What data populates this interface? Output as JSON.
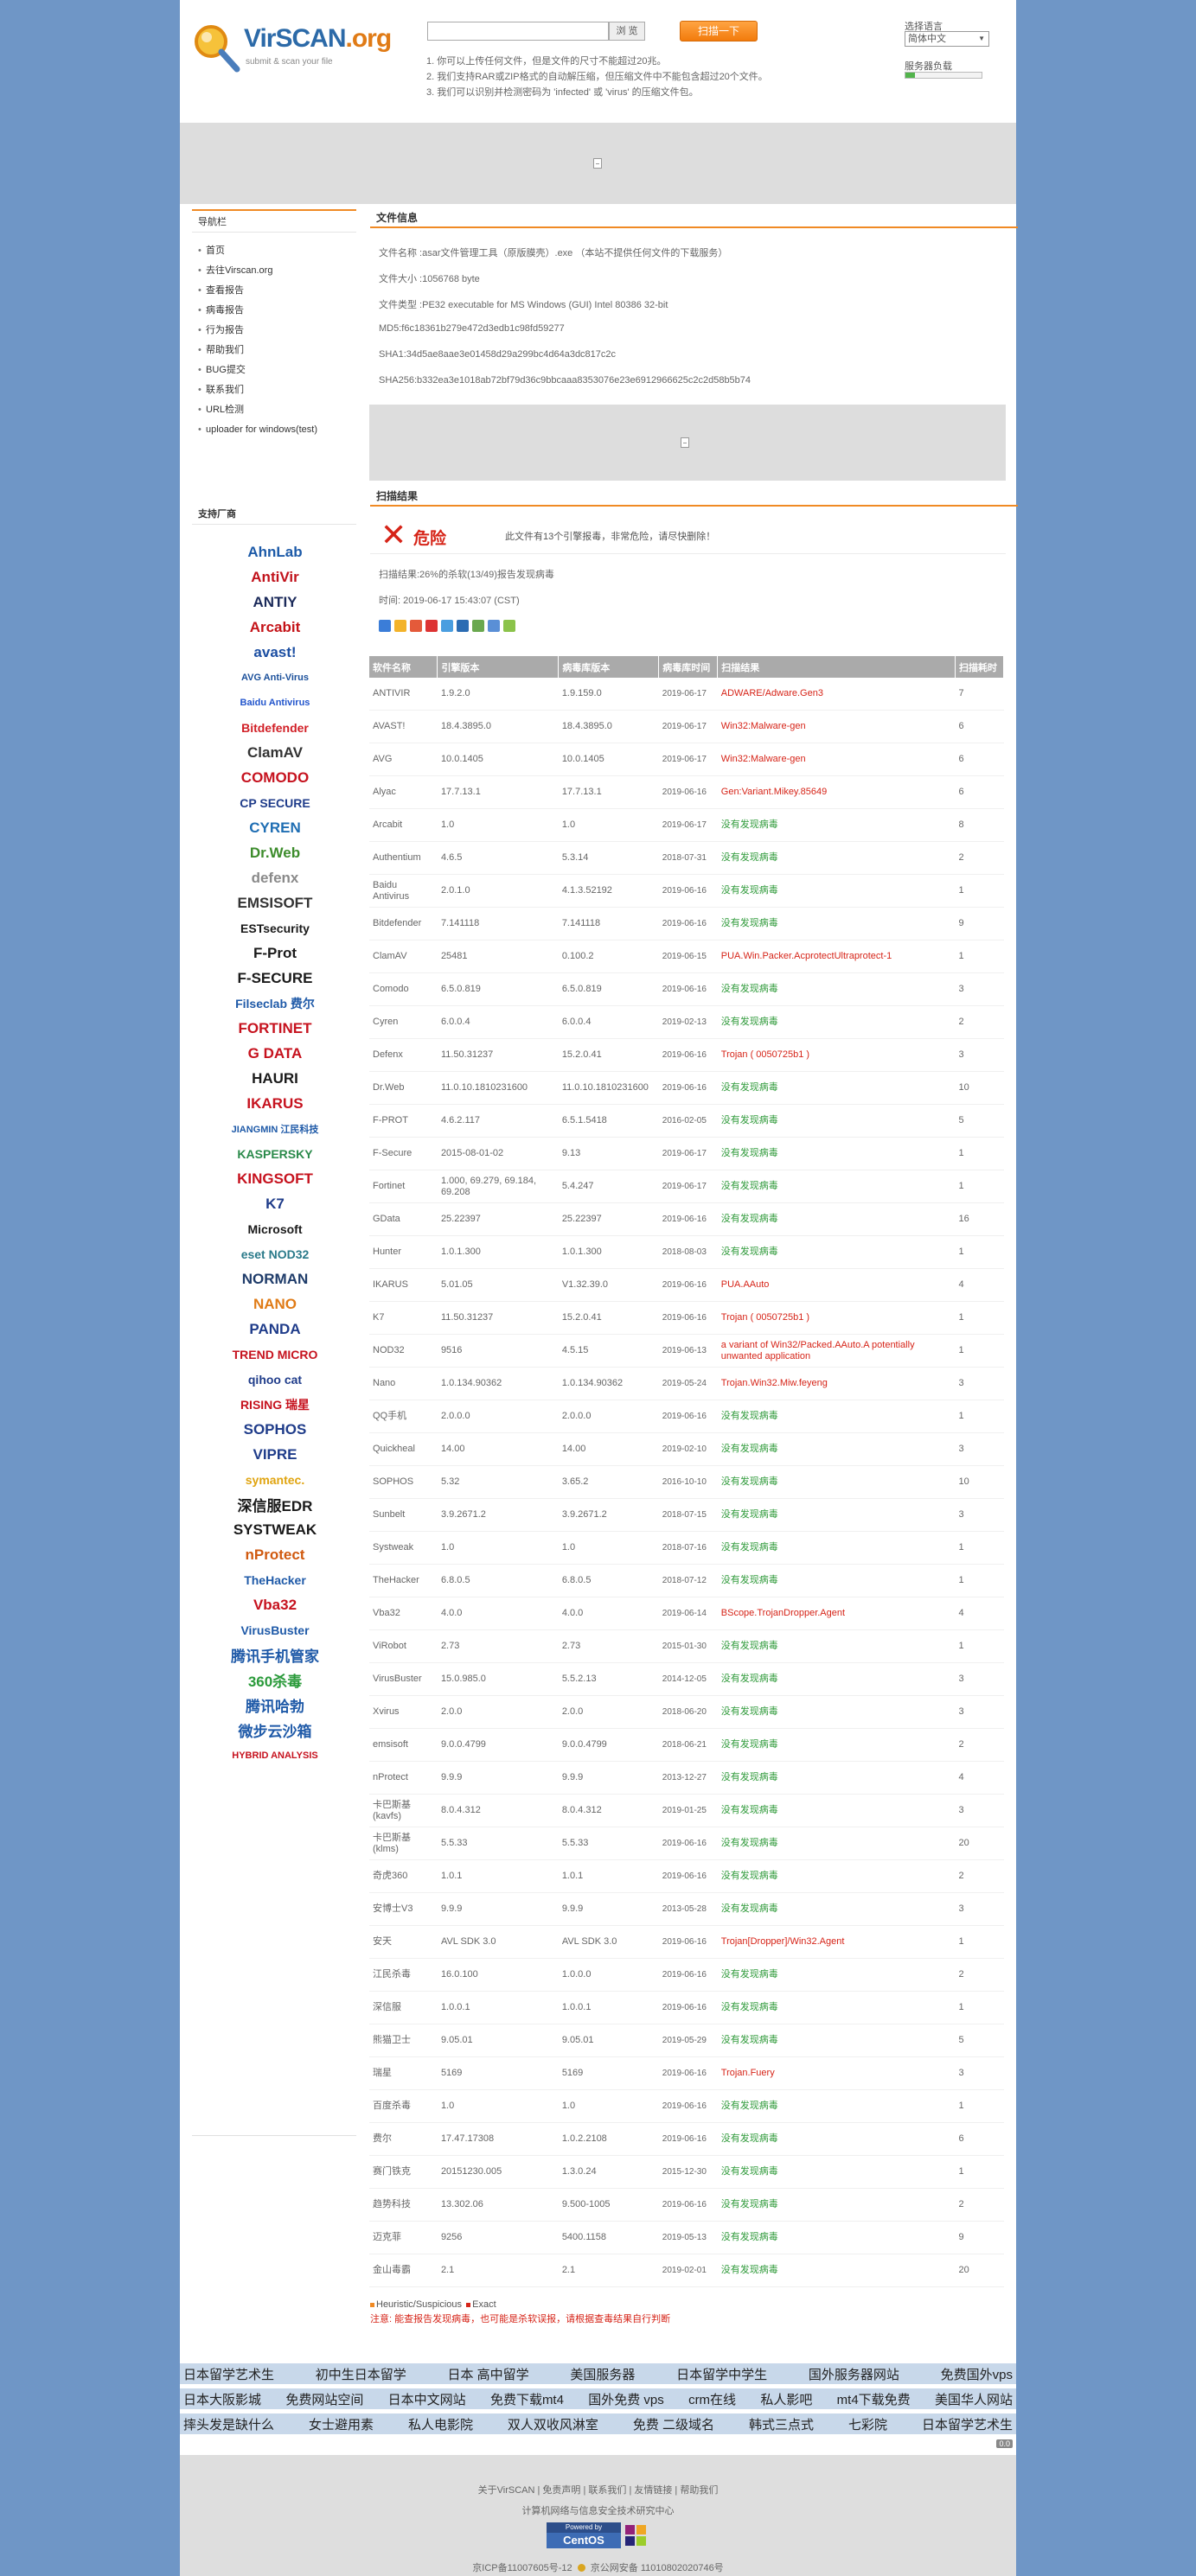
{
  "header": {
    "logo": "VirSCAN.org",
    "logo_main": "VirSCAN",
    "logo_tld": ".org",
    "logo_sub": "submit & scan your file",
    "browse_label": "浏 览",
    "scan_label": "扫描一下",
    "notes": [
      "1. 你可以上传任何文件，但是文件的尺寸不能超过20兆。",
      "2. 我们支持RAR或ZIP格式的自动解压缩，但压缩文件中不能包含超过20个文件。",
      "3. 我们可以识别并检测密码为 'infected' 或 'virus' 的压缩文件包。"
    ],
    "lang_label": "选择语言",
    "lang_value": "简体中文",
    "load_label": "服务器负载",
    "load_fraction": 0.12
  },
  "sidebar": {
    "nav_title": "导航栏",
    "nav_items": [
      "首页",
      "去往Virscan.org",
      "查看报告",
      "病毒报告",
      "行为报告",
      "帮助我们",
      "BUG提交",
      "联系我们",
      "URL检测",
      "uploader for windows(test)"
    ],
    "vendors_title": "支持厂商",
    "vendor_logos": [
      {
        "label": "AhnLab",
        "color": "#1c5aa8"
      },
      {
        "label": "AntiVir",
        "color": "#c1121b"
      },
      {
        "label": "ANTIY",
        "color": "#1b2a5a"
      },
      {
        "label": "Arcabit",
        "color": "#c41318"
      },
      {
        "label": "avast!",
        "color": "#1b4ea2"
      },
      {
        "label": "AVG Anti-Virus",
        "color": "#1a4f9a"
      },
      {
        "label": "Baidu Antivirus",
        "color": "#2255cc"
      },
      {
        "label": "Bitdefender",
        "color": "#d11f26"
      },
      {
        "label": "ClamAV",
        "color": "#333333"
      },
      {
        "label": "COMODO",
        "color": "#c6121e"
      },
      {
        "label": "CP SECURE",
        "color": "#1f3c8a"
      },
      {
        "label": "CYREN",
        "color": "#1f6eb3"
      },
      {
        "label": "Dr.Web",
        "color": "#3d8c2c"
      },
      {
        "label": "defenx",
        "color": "#8a8a8a"
      },
      {
        "label": "EMSISOFT",
        "color": "#333333"
      },
      {
        "label": "ESTsecurity",
        "color": "#1a1a1a"
      },
      {
        "label": "F-Prot",
        "color": "#1a1a1a"
      },
      {
        "label": "F-SECURE",
        "color": "#1a1a1a"
      },
      {
        "label": "Filseclab 费尔",
        "color": "#1f5aa8"
      },
      {
        "label": "FORTINET",
        "color": "#c6121e"
      },
      {
        "label": "G DATA",
        "color": "#c6121e"
      },
      {
        "label": "HAURI",
        "color": "#1a1a1a"
      },
      {
        "label": "IKARUS",
        "color": "#c6121e"
      },
      {
        "label": "JIANGMIN 江民科技",
        "color": "#1f5aa8"
      },
      {
        "label": "KASPERSKY",
        "color": "#2a8a4a"
      },
      {
        "label": "KINGSOFT",
        "color": "#c6121e"
      },
      {
        "label": "K7",
        "color": "#1f3c8a"
      },
      {
        "label": "Microsoft",
        "color": "#1a1a1a"
      },
      {
        "label": "eset NOD32",
        "color": "#2a7a8a"
      },
      {
        "label": "NORMAN",
        "color": "#1f3c6a"
      },
      {
        "label": "NANO",
        "color": "#e07b16"
      },
      {
        "label": "PANDA",
        "color": "#1f3c8a"
      },
      {
        "label": "TREND MICRO",
        "color": "#c6121e"
      },
      {
        "label": "qihoo cat",
        "color": "#1f3c8a"
      },
      {
        "label": "RISING 瑞星",
        "color": "#c6121e"
      },
      {
        "label": "SOPHOS",
        "color": "#1f3c8a"
      },
      {
        "label": "VIPRE",
        "color": "#1f3c8a"
      },
      {
        "label": "symantec.",
        "color": "#e0a410"
      },
      {
        "label": "深信服EDR",
        "color": "#1a1a1a"
      },
      {
        "label": "SYSTWEAK",
        "color": "#1a1a1a"
      },
      {
        "label": "nProtect",
        "color": "#d05a10"
      },
      {
        "label": "TheHacker",
        "color": "#1f5aa8"
      },
      {
        "label": "Vba32",
        "color": "#c6121e"
      },
      {
        "label": "VirusBuster",
        "color": "#1f5aa8"
      },
      {
        "label": "腾讯手机管家",
        "color": "#1f5aa8"
      },
      {
        "label": "360杀毒",
        "color": "#2a9a3a"
      },
      {
        "label": "腾讯哈勃",
        "color": "#1f5aa8"
      },
      {
        "label": "微步云沙箱",
        "color": "#1f5aa8"
      },
      {
        "label": "HYBRID ANALYSIS",
        "color": "#c6121e"
      }
    ]
  },
  "file_info": {
    "title": "文件信息",
    "name": "文件名称 :asar文件管理工具（原版膜壳）.exe （本站不提供任何文件的下载服务）",
    "size": "文件大小 :1056768 byte",
    "type": "文件类型 :PE32 executable for MS Windows (GUI) Intel 80386 32-bit",
    "md5": "MD5:f6c18361b279e472d3edb1c98fd59277",
    "sha1": "SHA1:34d5ae8aae3e01458d29a299bc4d64a3dc817c2c",
    "sha256": "SHA256:b332ea3e1018ab72bf79d36c9bbcaaa8353076e23e6912966625c2c2d58b5b74"
  },
  "scan": {
    "title": "扫描结果",
    "level": "危险",
    "summary": "此文件有13个引擎报毒，非常危险，请尽快删除！",
    "rate": "扫描结果:26%的杀软(13/49)报告发现病毒",
    "time": "时间: 2019-06-17 15:43:07 (CST)",
    "headers": [
      "软件名称",
      "引擎版本",
      "病毒库版本",
      "病毒库时间",
      "扫描结果",
      "扫描耗时"
    ],
    "rows": [
      [
        "ANTIVIR",
        "1.9.2.0",
        "1.9.159.0",
        "2019-06-17",
        "ADWARE/Adware.Gen3",
        "7",
        "red"
      ],
      [
        "AVAST!",
        "18.4.3895.0",
        "18.4.3895.0",
        "2019-06-17",
        "Win32:Malware-gen",
        "6",
        "red"
      ],
      [
        "AVG",
        "10.0.1405",
        "10.0.1405",
        "2019-06-17",
        "Win32:Malware-gen",
        "6",
        "red"
      ],
      [
        "Alyac",
        "17.7.13.1",
        "17.7.13.1",
        "2019-06-16",
        "Gen:Variant.Mikey.85649",
        "6",
        "red"
      ],
      [
        "Arcabit",
        "1.0",
        "1.0",
        "2019-06-17",
        "没有发现病毒",
        "8",
        "green"
      ],
      [
        "Authentium",
        "4.6.5",
        "5.3.14",
        "2018-07-31",
        "没有发现病毒",
        "2",
        "green"
      ],
      [
        "Baidu Antivirus",
        "2.0.1.0",
        "4.1.3.52192",
        "2019-06-16",
        "没有发现病毒",
        "1",
        "green"
      ],
      [
        "Bitdefender",
        "7.141118",
        "7.141118",
        "2019-06-16",
        "没有发现病毒",
        "9",
        "green"
      ],
      [
        "ClamAV",
        "25481",
        "0.100.2",
        "2019-06-15",
        "PUA.Win.Packer.AcprotectUltraprotect-1",
        "1",
        "red"
      ],
      [
        "Comodo",
        "6.5.0.819",
        "6.5.0.819",
        "2019-06-16",
        "没有发现病毒",
        "3",
        "green"
      ],
      [
        "Cyren",
        "6.0.0.4",
        "6.0.0.4",
        "2019-02-13",
        "没有发现病毒",
        "2",
        "green"
      ],
      [
        "Defenx",
        "11.50.31237",
        "15.2.0.41",
        "2019-06-16",
        "Trojan ( 0050725b1 )",
        "3",
        "red"
      ],
      [
        "Dr.Web",
        "11.0.10.1810231600",
        "11.0.10.1810231600",
        "2019-06-16",
        "没有发现病毒",
        "10",
        "green"
      ],
      [
        "F-PROT",
        "4.6.2.117",
        "6.5.1.5418",
        "2016-02-05",
        "没有发现病毒",
        "5",
        "green"
      ],
      [
        "F-Secure",
        "2015-08-01-02",
        "9.13",
        "2019-06-17",
        "没有发现病毒",
        "1",
        "green"
      ],
      [
        "Fortinet",
        "1.000, 69.279, 69.184, 69.208",
        "5.4.247",
        "2019-06-17",
        "没有发现病毒",
        "1",
        "green"
      ],
      [
        "GData",
        "25.22397",
        "25.22397",
        "2019-06-16",
        "没有发现病毒",
        "16",
        "green"
      ],
      [
        "Hunter",
        "1.0.1.300",
        "1.0.1.300",
        "2018-08-03",
        "没有发现病毒",
        "1",
        "green"
      ],
      [
        "IKARUS",
        "5.01.05",
        "V1.32.39.0",
        "2019-06-16",
        "PUA.AAuto",
        "4",
        "red"
      ],
      [
        "K7",
        "11.50.31237",
        "15.2.0.41",
        "2019-06-16",
        "Trojan ( 0050725b1 )",
        "1",
        "red"
      ],
      [
        "NOD32",
        "9516",
        "4.5.15",
        "2019-06-13",
        "a variant of Win32/Packed.AAuto.A potentially unwanted application",
        "1",
        "red"
      ],
      [
        "Nano",
        "1.0.134.90362",
        "1.0.134.90362",
        "2019-05-24",
        "Trojan.Win32.Miw.feyeng",
        "3",
        "red"
      ],
      [
        "QQ手机",
        "2.0.0.0",
        "2.0.0.0",
        "2019-06-16",
        "没有发现病毒",
        "1",
        "green"
      ],
      [
        "Quickheal",
        "14.00",
        "14.00",
        "2019-02-10",
        "没有发现病毒",
        "3",
        "green"
      ],
      [
        "SOPHOS",
        "5.32",
        "3.65.2",
        "2016-10-10",
        "没有发现病毒",
        "10",
        "green"
      ],
      [
        "Sunbelt",
        "3.9.2671.2",
        "3.9.2671.2",
        "2018-07-15",
        "没有发现病毒",
        "3",
        "green"
      ],
      [
        "Systweak",
        "1.0",
        "1.0",
        "2018-07-16",
        "没有发现病毒",
        "1",
        "green"
      ],
      [
        "TheHacker",
        "6.8.0.5",
        "6.8.0.5",
        "2018-07-12",
        "没有发现病毒",
        "1",
        "green"
      ],
      [
        "Vba32",
        "4.0.0",
        "4.0.0",
        "2019-06-14",
        "BScope.TrojanDropper.Agent",
        "4",
        "red"
      ],
      [
        "ViRobot",
        "2.73",
        "2.73",
        "2015-01-30",
        "没有发现病毒",
        "1",
        "green"
      ],
      [
        "VirusBuster",
        "15.0.985.0",
        "5.5.2.13",
        "2014-12-05",
        "没有发现病毒",
        "3",
        "green"
      ],
      [
        "Xvirus",
        "2.0.0",
        "2.0.0",
        "2018-06-20",
        "没有发现病毒",
        "3",
        "green"
      ],
      [
        "emsisoft",
        "9.0.0.4799",
        "9.0.0.4799",
        "2018-06-21",
        "没有发现病毒",
        "2",
        "green"
      ],
      [
        "nProtect",
        "9.9.9",
        "9.9.9",
        "2013-12-27",
        "没有发现病毒",
        "4",
        "green"
      ],
      [
        "卡巴斯基(kavfs)",
        "8.0.4.312",
        "8.0.4.312",
        "2019-01-25",
        "没有发现病毒",
        "3",
        "green"
      ],
      [
        "卡巴斯基(klms)",
        "5.5.33",
        "5.5.33",
        "2019-06-16",
        "没有发现病毒",
        "20",
        "green"
      ],
      [
        "奇虎360",
        "1.0.1",
        "1.0.1",
        "2019-06-16",
        "没有发现病毒",
        "2",
        "green"
      ],
      [
        "安博士V3",
        "9.9.9",
        "9.9.9",
        "2013-05-28",
        "没有发现病毒",
        "3",
        "green"
      ],
      [
        "安天",
        "AVL SDK 3.0",
        "AVL SDK 3.0",
        "2019-06-16",
        "Trojan[Dropper]/Win32.Agent",
        "1",
        "red"
      ],
      [
        "江民杀毒",
        "16.0.100",
        "1.0.0.0",
        "2019-06-16",
        "没有发现病毒",
        "2",
        "green"
      ],
      [
        "深信服",
        "1.0.0.1",
        "1.0.0.1",
        "2019-06-16",
        "没有发现病毒",
        "1",
        "green"
      ],
      [
        "熊猫卫士",
        "9.05.01",
        "9.05.01",
        "2019-05-29",
        "没有发现病毒",
        "5",
        "green"
      ],
      [
        "瑞星",
        "5169",
        "5169",
        "2019-06-16",
        "Trojan.Fuery",
        "3",
        "red"
      ],
      [
        "百度杀毒",
        "1.0",
        "1.0",
        "2019-06-16",
        "没有发现病毒",
        "1",
        "green"
      ],
      [
        "费尔",
        "17.47.17308",
        "1.0.2.2108",
        "2019-06-16",
        "没有发现病毒",
        "6",
        "green"
      ],
      [
        "赛门铁克",
        "20151230.005",
        "1.3.0.24",
        "2015-12-30",
        "没有发现病毒",
        "1",
        "green"
      ],
      [
        "趋势科技",
        "13.302.06",
        "9.500-1005",
        "2019-06-16",
        "没有发现病毒",
        "2",
        "green"
      ],
      [
        "迈克菲",
        "9256",
        "5400.1158",
        "2019-05-13",
        "没有发现病毒",
        "9",
        "green"
      ],
      [
        "金山毒霸",
        "2.1",
        "2.1",
        "2019-02-01",
        "没有发现病毒",
        "20",
        "green"
      ]
    ],
    "legend_orange": "Heuristic/Suspicious",
    "legend_red": "Exact",
    "warning": "注意: 能查报告发现病毒，也可能是杀软误报，请根据查毒结果自行判断"
  },
  "links": {
    "row1": [
      "日本留学艺术生",
      "初中生日本留学",
      "日本 高中留学",
      "美国服务器",
      "日本留学中学生",
      "国外服务器网站",
      "免费国外vps"
    ],
    "row2": [
      "日本大阪影城",
      "免费网站空间",
      "日本中文网站",
      "免费下载mt4",
      "国外免费 vps",
      "crm在线",
      "私人影吧",
      "mt4下载免费",
      "美国华人网站"
    ],
    "row3": [
      "摔头发是缺什么",
      "女士避用素",
      "私人电影院",
      "双人双收风淋室",
      "免费 二级域名",
      "韩式三点式",
      "七彩院",
      "日本留学艺术生"
    ]
  },
  "footer": {
    "links": "关于VirSCAN | 免责声明 | 联系我们 | 友情链接 | 帮助我们",
    "org": "计算机网络与信息安全技术研究中心",
    "powered": "Powered by",
    "centos": "CentOS",
    "icp": "京ICP备11007605号-12",
    "police": "京公网安备 11010802020746号",
    "badge": "0.0"
  }
}
